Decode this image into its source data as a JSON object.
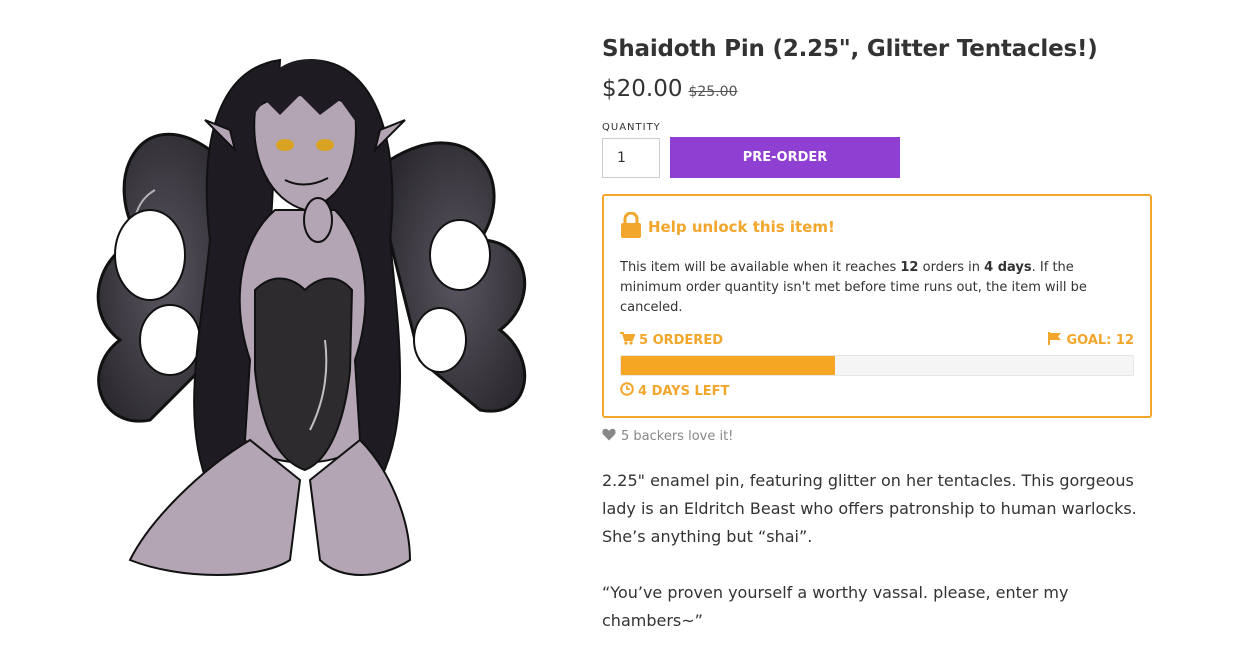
{
  "product": {
    "title": "Shaidoth Pin (2.25\", Glitter Tentacles!)",
    "price": "$20.00",
    "compare_price": "$25.00",
    "image_alt": "Shaidoth enamel pin artwork"
  },
  "purchase": {
    "quantity_label": "QUANTITY",
    "quantity_value": "1",
    "preorder_label": "PRE-ORDER"
  },
  "unlock": {
    "heading": "Help unlock this item!",
    "desc_1": "This item will be available when it reaches ",
    "desc_orders": "12",
    "desc_2": " orders in ",
    "desc_days": "4 days",
    "desc_3": ". If the minimum order quantity isn't met before time runs out, the item will be canceled.",
    "ordered": "5 ORDERED",
    "goal": "GOAL: 12",
    "progress_fraction": 0.417,
    "days_left": "4 DAYS LEFT"
  },
  "backers": "5 backers love it!",
  "description": {
    "p1": "2.25\" enamel pin, featuring glitter on her tentacles. This gorgeous lady is an Eldritch Beast who offers patronship to human warlocks. She’s anything but “shai”.",
    "p2": "“You’ve proven yourself a worthy vassal. please, enter my chambers~”"
  },
  "colors": {
    "accent_orange": "#f2a62b",
    "button_purple": "#8f3fd1"
  },
  "icons": {
    "lock": "lock-icon",
    "cart": "cart-icon",
    "flag": "flag-icon",
    "clock": "clock-icon",
    "heart": "heart-icon"
  }
}
